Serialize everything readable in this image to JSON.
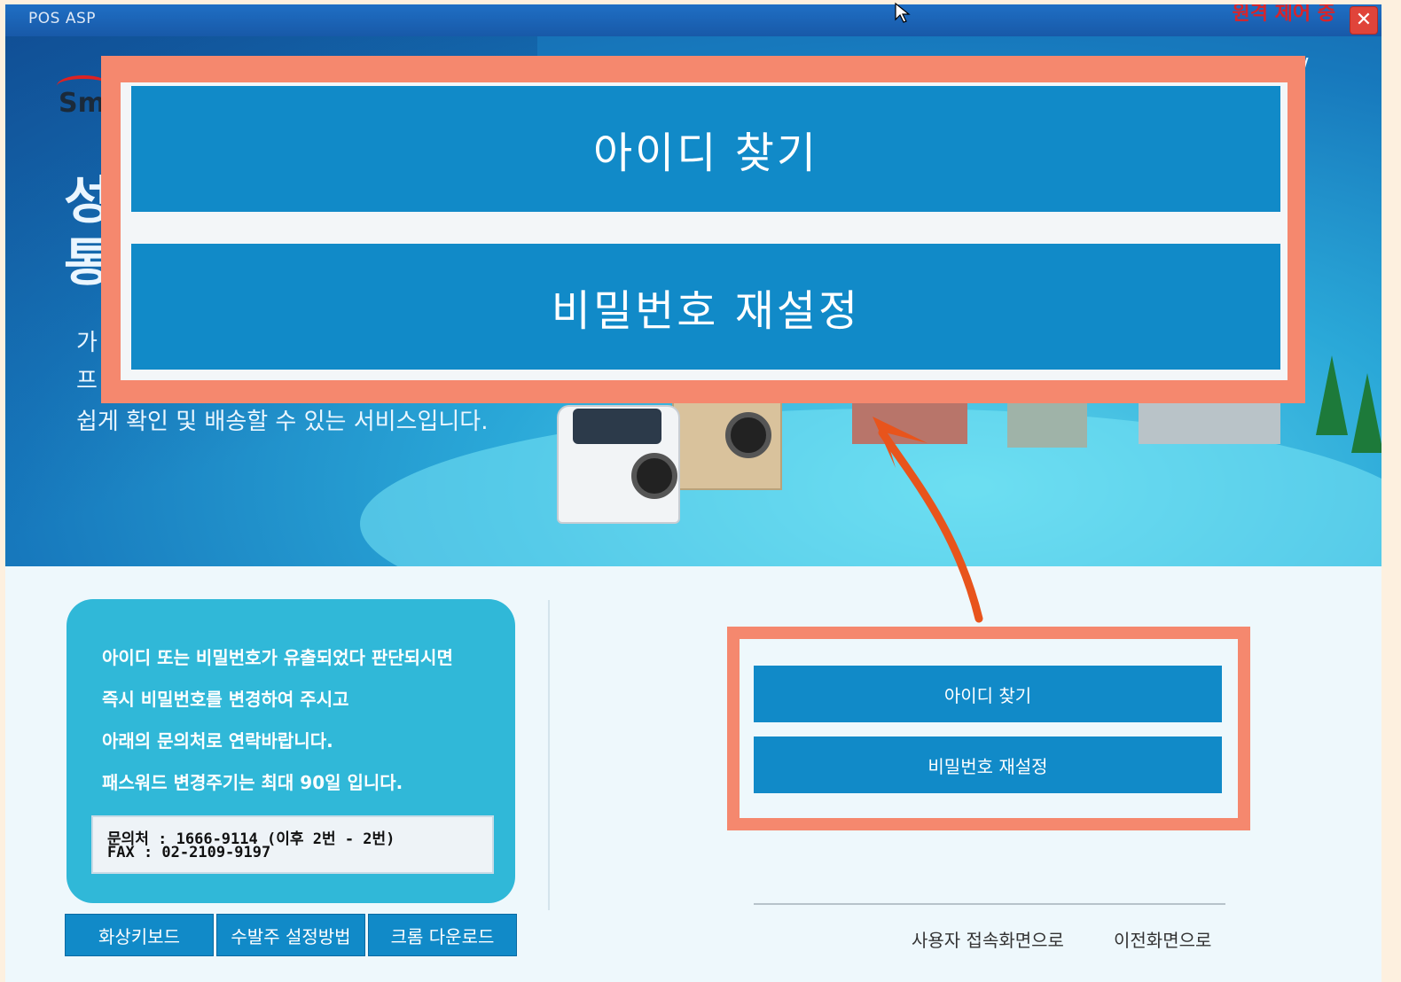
{
  "window": {
    "title": "POS ASP",
    "status_text": "원격 제어 중",
    "close_symbol": "✕"
  },
  "hero": {
    "logo_text": "Sm",
    "big_text_1": "성",
    "big_text_2": "통",
    "line_1": "가",
    "line_2": "프",
    "line_3": "쉽게 확인 및 배송할 수 있는 서비스입니다.",
    "url_fragment": "r/"
  },
  "popup": {
    "find_id_label": "아이디 찾기",
    "reset_password_label": "비밀번호 재설정"
  },
  "info": {
    "lines": [
      "아이디 또는 비밀번호가 유출되었다 판단되시면",
      "즉시 비밀번호를 변경하여 주시고",
      "아래의 문의처로 연락바랍니다.",
      "패스워드 변경주기는 최대 90일 입니다."
    ],
    "contact_phone": "문의처 : 1666-9114 (이후 2번 - 2번)",
    "contact_fax": "FAX : 02-2109-9197"
  },
  "bottom_buttons": [
    "화상키보드",
    "수발주 설정방법",
    "크롬 다운로드"
  ],
  "right_panel": {
    "find_id_label": "아이디 찾기",
    "reset_password_label": "비밀번호 재설정"
  },
  "links": {
    "user_login": "사용자 접속화면으로",
    "previous": "이전화면으로"
  },
  "colors": {
    "button_blue": "#118ac8",
    "highlight": "#f5886e",
    "arrow": "#e8541c",
    "titlebar": "#1f6fc4"
  }
}
